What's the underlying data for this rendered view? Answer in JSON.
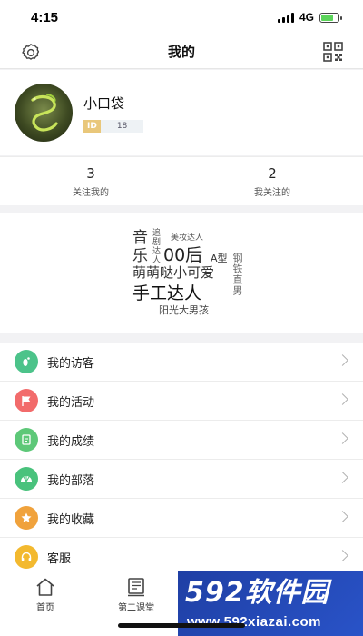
{
  "status_bar": {
    "time": "4:15",
    "network": "4G"
  },
  "header": {
    "title": "我的"
  },
  "profile": {
    "username": "小口袋",
    "id_label": "ID",
    "id_value": "18"
  },
  "follow_stats": [
    {
      "count": "3",
      "label": "关注我的"
    },
    {
      "count": "2",
      "label": "我关注的"
    }
  ],
  "tags": {
    "music_1": "音",
    "music_2": "乐",
    "zhuiju": "追剧达人",
    "meizhuang": "美妆达人",
    "houbei": "00后",
    "axing": "A型",
    "gangtie": "钢铁直男",
    "mengmeng": "萌萌哒小可爱",
    "shougong": "手工达人",
    "yangguang": "阳光大男孩"
  },
  "menu": [
    {
      "label": "我的访客",
      "icon": "footprint-icon",
      "color": "#4cc38a"
    },
    {
      "label": "我的活动",
      "icon": "flag-icon",
      "color": "#f26b6b"
    },
    {
      "label": "我的成绩",
      "icon": "report-icon",
      "color": "#5dc878"
    },
    {
      "label": "我的部落",
      "icon": "tribe-icon",
      "color": "#49c27c"
    },
    {
      "label": "我的收藏",
      "icon": "star-icon",
      "color": "#f0a23c"
    },
    {
      "label": "客服",
      "icon": "headset-icon",
      "color": "#f3b92f"
    }
  ],
  "tab_bar": [
    {
      "label": "首页",
      "icon": "home-icon"
    },
    {
      "label": "第二课堂",
      "icon": "classroom-icon"
    }
  ],
  "watermark": {
    "main": "592软件园",
    "sub": "www.592xiazai.com"
  }
}
